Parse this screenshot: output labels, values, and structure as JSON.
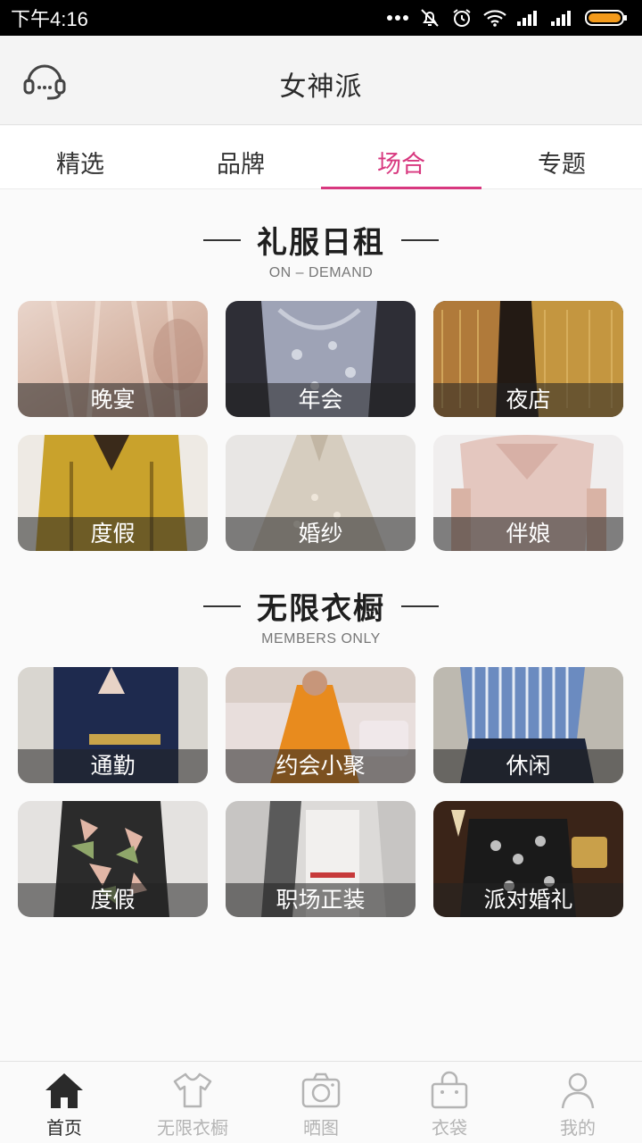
{
  "status_bar": {
    "time": "下午4:16"
  },
  "app_bar": {
    "title": "女神派"
  },
  "tabs": [
    {
      "label": "精选"
    },
    {
      "label": "品牌"
    },
    {
      "label": "场合",
      "active": true
    },
    {
      "label": "专题"
    }
  ],
  "sections": [
    {
      "title": "礼服日租",
      "subtitle": "ON – DEMAND",
      "cards": [
        {
          "label": "晚宴"
        },
        {
          "label": "年会"
        },
        {
          "label": "夜店"
        },
        {
          "label": "度假"
        },
        {
          "label": "婚纱"
        },
        {
          "label": "伴娘"
        }
      ]
    },
    {
      "title": "无限衣橱",
      "subtitle": "MEMBERS ONLY",
      "cards": [
        {
          "label": "通勤"
        },
        {
          "label": "约会小聚"
        },
        {
          "label": "休闲"
        },
        {
          "label": "度假"
        },
        {
          "label": "职场正装"
        },
        {
          "label": "派对婚礼"
        }
      ]
    }
  ],
  "bottom_nav": [
    {
      "label": "首页",
      "icon": "home-icon",
      "active": true
    },
    {
      "label": "无限衣橱",
      "icon": "tshirt-icon"
    },
    {
      "label": "晒图",
      "icon": "camera-icon"
    },
    {
      "label": "衣袋",
      "icon": "bag-icon"
    },
    {
      "label": "我的",
      "icon": "person-icon"
    }
  ],
  "colors": {
    "accent": "#d8387f",
    "nav_active": "#2a2a2a",
    "nav_inactive": "#b4b4b4"
  }
}
